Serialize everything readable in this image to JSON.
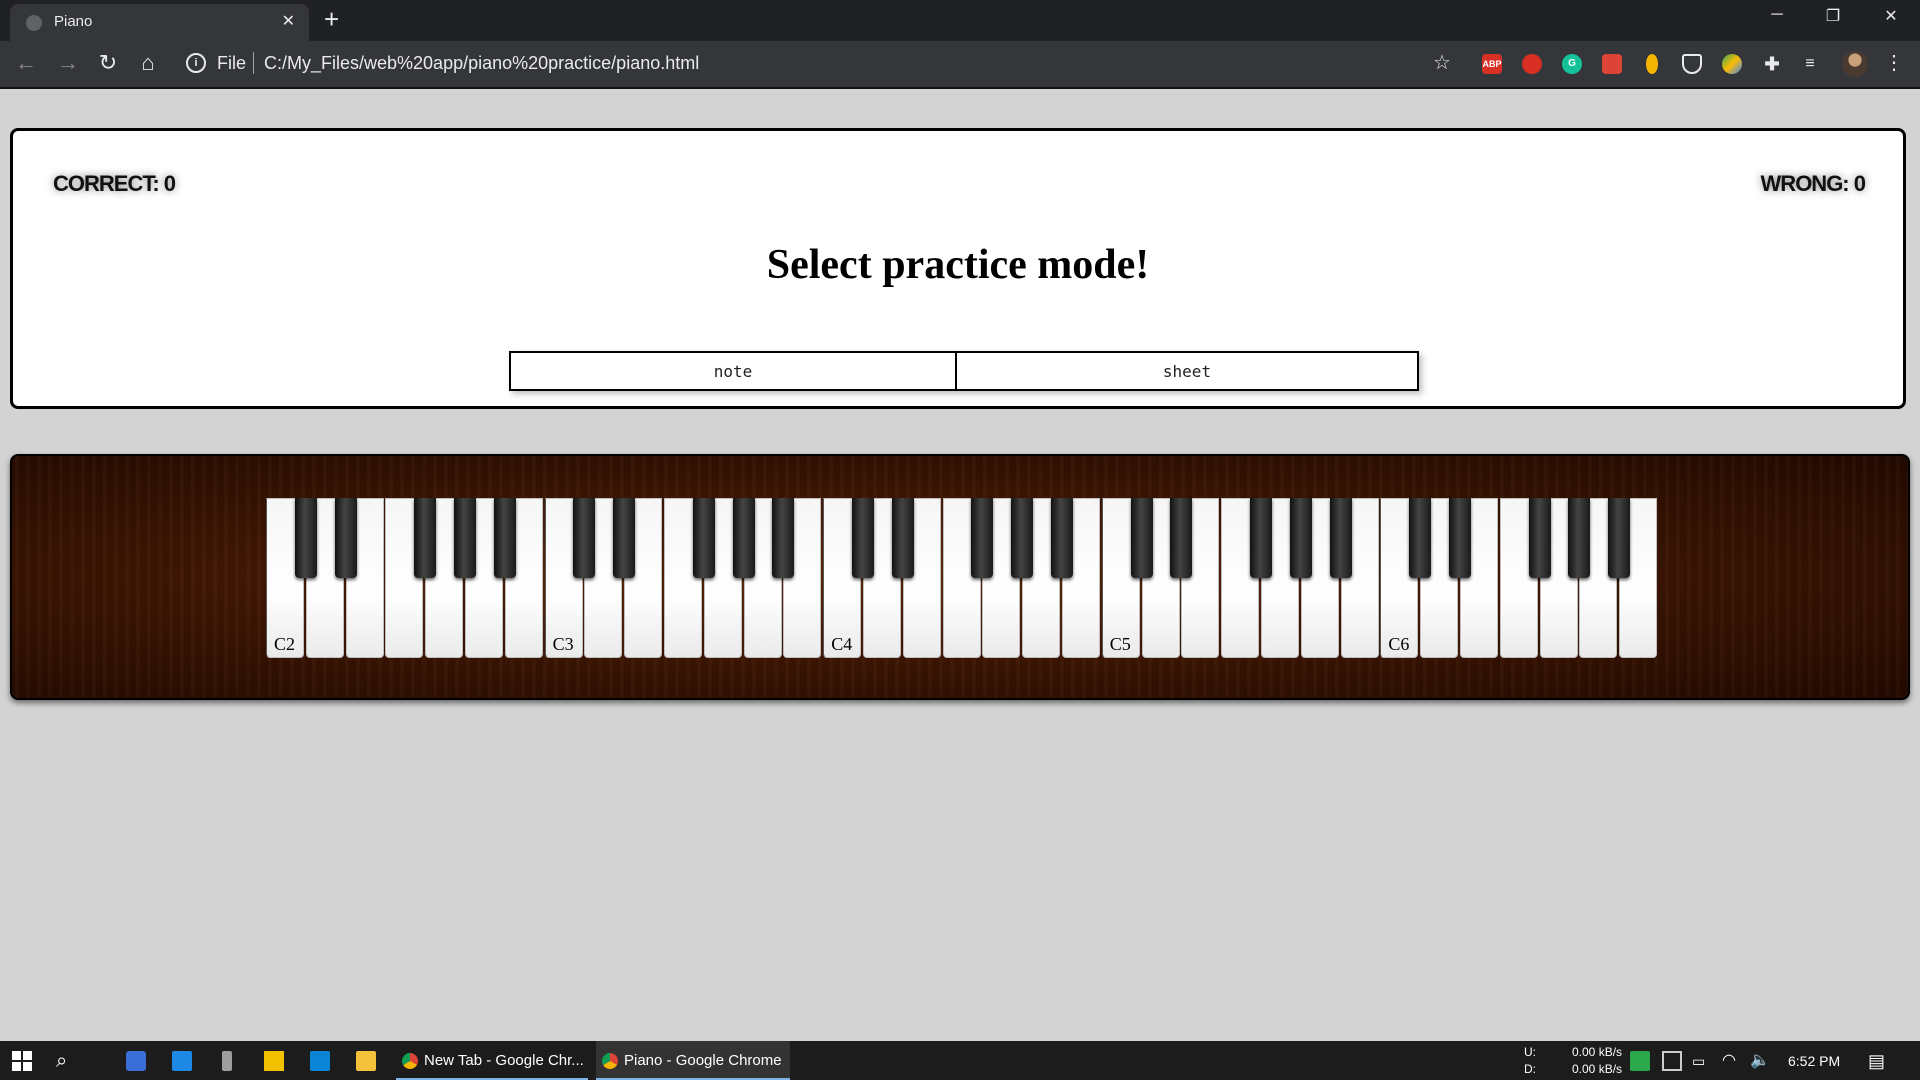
{
  "browser": {
    "tab_title": "Piano",
    "address_scheme": "File",
    "address_url": "C:/My_Files/web%20app/piano%20practice/piano.html",
    "extensions": [
      "ABP",
      "",
      "G",
      "",
      "",
      "",
      "",
      "",
      "",
      ""
    ]
  },
  "score": {
    "correct_label": "CORRECT: 0",
    "wrong_label": "WRONG: 0"
  },
  "headline": "Select practice mode!",
  "modes": {
    "note": "note",
    "sheet": "sheet"
  },
  "piano": {
    "octave_labels": [
      "C2",
      "C3",
      "C4",
      "C5",
      "C6"
    ],
    "white_keys_per_octave": 7,
    "black_key_offsets_per_octave": [
      1,
      2,
      4,
      5,
      6
    ],
    "colors": {
      "wood_dark": "#230a01",
      "wood_mid": "#5b2608",
      "key_white": "#ffffff",
      "key_black": "#111111"
    }
  },
  "taskbar": {
    "apps": [
      {
        "label": "New Tab - Google Chr..."
      },
      {
        "label": "Piano - Google Chrome"
      }
    ],
    "net_up_label": "U:",
    "net_down_label": "D:",
    "net_up": "0.00 kB/s",
    "net_down": "0.00 kB/s",
    "clock": "6:52 PM"
  }
}
